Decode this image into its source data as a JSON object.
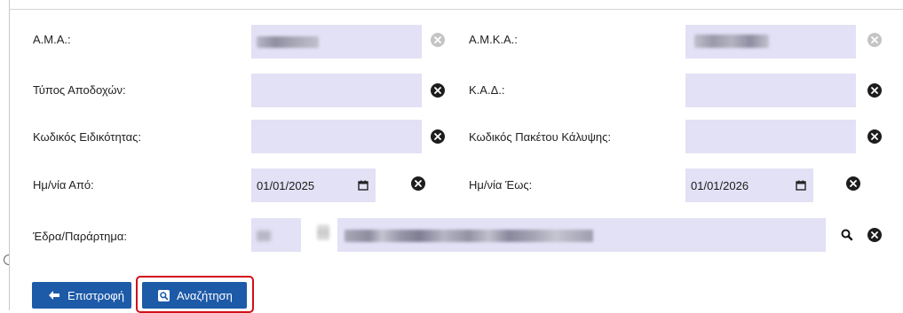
{
  "form": {
    "ama_label": "Α.Μ.Α.:",
    "amka_label": "Α.Μ.Κ.Α.:",
    "tipos_label": "Τύπος Αποδοχών:",
    "kad_label": "Κ.Α.Δ.:",
    "eidikotitas_label": "Κωδικός Ειδικότητας:",
    "paketo_label": "Κωδικός Πακέτου Κάλυψης:",
    "date_from_label": "Ημ/νία Από:",
    "date_to_label": "Ημ/νία Έως:",
    "date_from_value": "01/01/2025",
    "date_to_value": "01/01/2026",
    "edra_label": "Έδρα/Παράρτημα:"
  },
  "icons": {
    "clear": "times-circle-icon",
    "calendar": "calendar-icon",
    "search": "magnifier-icon",
    "back": "arrow-left-icon",
    "search_button": "search-square-icon"
  },
  "buttons": {
    "back_label": "Επιστροφή",
    "search_label": "Αναζήτηση"
  },
  "colors": {
    "field_bg": "#e3e1f5",
    "button_bg": "#1d5aa8",
    "highlight": "#d0101a"
  }
}
